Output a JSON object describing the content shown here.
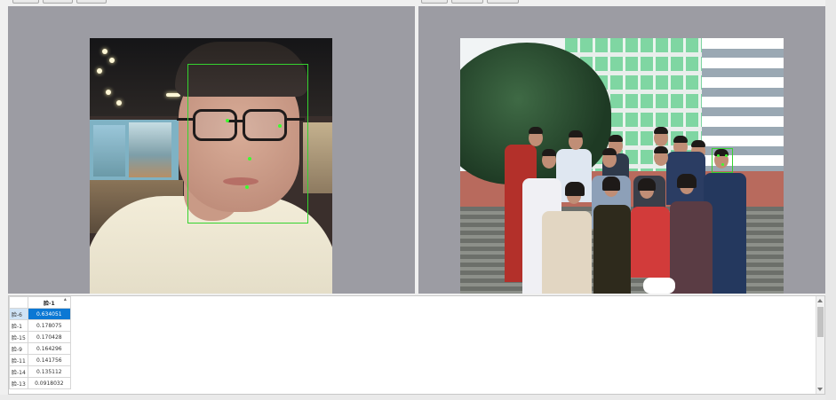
{
  "toolbar": {
    "left_buttons": [
      "",
      "",
      ""
    ],
    "right_buttons": [
      "",
      "",
      ""
    ]
  },
  "panes": {
    "left": {
      "image": "photo-of-man-with-glasses",
      "face_detections": 1
    },
    "right": {
      "image": "group-photo-in-front-of-building",
      "face_detections": 1
    }
  },
  "table": {
    "column_header": "脸-1",
    "rows": [
      {
        "label": "脸-6",
        "value": "0.634051",
        "selected": true
      },
      {
        "label": "脸-1",
        "value": "0.178075",
        "selected": false
      },
      {
        "label": "脸-15",
        "value": "0.170428",
        "selected": false
      },
      {
        "label": "脸-9",
        "value": "0.164296",
        "selected": false
      },
      {
        "label": "脸-11",
        "value": "0.141756",
        "selected": false
      },
      {
        "label": "脸-14",
        "value": "0.135112",
        "selected": false
      },
      {
        "label": "脸-13",
        "value": "0.0918032",
        "selected": false
      }
    ]
  },
  "colors": {
    "canvas_bg": "#9c9ca3",
    "detection_box": "#35d32f",
    "selection": "#0b78d4"
  }
}
